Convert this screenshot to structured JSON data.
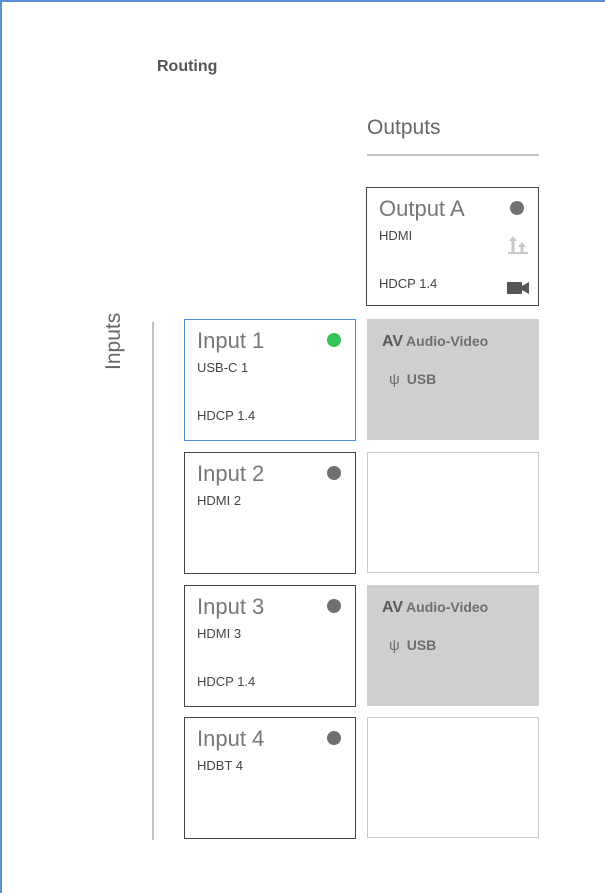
{
  "routing": {
    "title": "Routing",
    "outputs_label": "Outputs",
    "inputs_label": "Inputs"
  },
  "output": {
    "name": "Output A",
    "port": "HDMI",
    "hdcp": "HDCP 1.4",
    "status_color": "#707070"
  },
  "inputs": [
    {
      "name": "Input 1",
      "port": "USB-C 1",
      "hdcp": "HDCP 1.4",
      "status": "active",
      "status_color": "#34c45a",
      "selected": true
    },
    {
      "name": "Input 2",
      "port": "HDMI 2",
      "hdcp": "",
      "status": "inactive",
      "status_color": "#707070",
      "selected": false
    },
    {
      "name": "Input 3",
      "port": "HDMI 3",
      "hdcp": "HDCP 1.4",
      "status": "inactive",
      "status_color": "#707070",
      "selected": false
    },
    {
      "name": "Input 4",
      "port": "HDBT 4",
      "hdcp": "",
      "status": "inactive",
      "status_color": "#707070",
      "selected": false
    }
  ],
  "matrix": [
    {
      "connected": true,
      "av_abbr": "AV",
      "av_label": "Audio-Video",
      "usb_label": "USB"
    },
    {
      "connected": false
    },
    {
      "connected": true,
      "av_abbr": "AV",
      "av_label": "Audio-Video",
      "usb_label": "USB"
    },
    {
      "connected": false
    }
  ],
  "icons": {
    "output_upload": "upload-icon",
    "output_camera": "video-camera-icon",
    "usb": "usb-icon"
  },
  "colors": {
    "selected_border": "#4a90d9",
    "active_dot": "#34c45a",
    "connected_cell": "#cfcfcf"
  }
}
